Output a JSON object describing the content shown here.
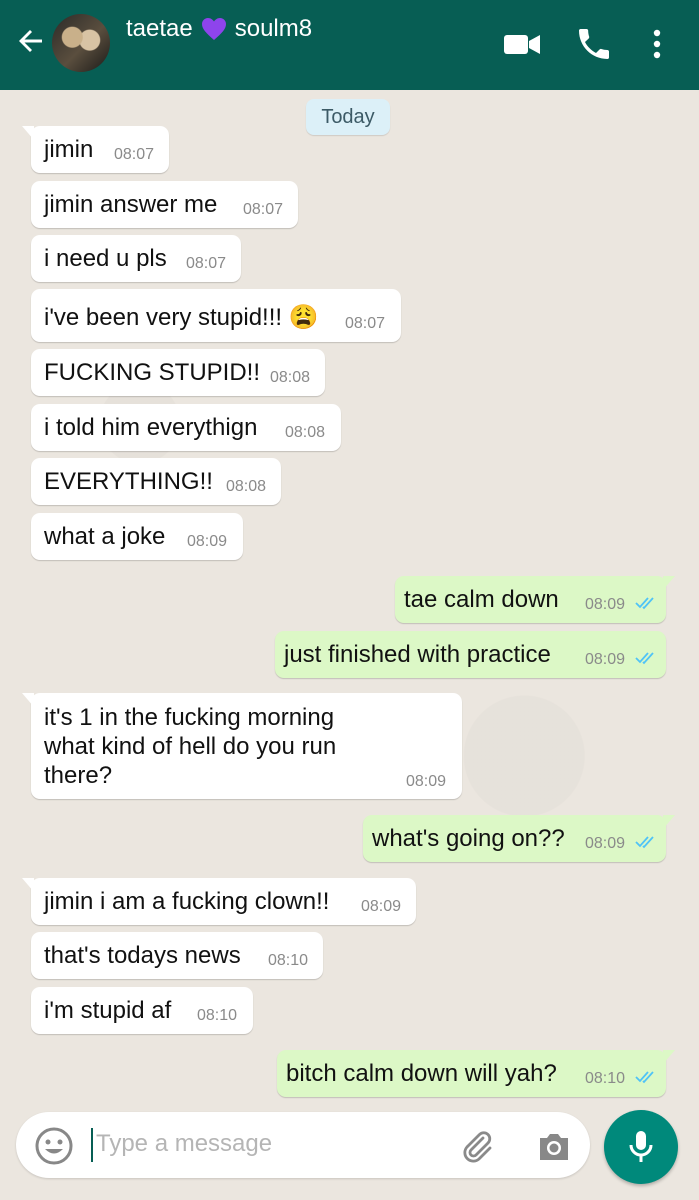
{
  "header": {
    "contact_name_left": "taetae",
    "contact_name_right": "soulm8",
    "icons": [
      "back-arrow-icon",
      "avatar",
      "purple-heart-icon",
      "video-call-icon",
      "phone-icon",
      "more-options-icon"
    ]
  },
  "date_chip": "Today",
  "messages": [
    {
      "dir": "in",
      "text": "jimin",
      "time": "08:07"
    },
    {
      "dir": "in",
      "text": "jimin answer me",
      "time": "08:07"
    },
    {
      "dir": "in",
      "text": "i need u pls",
      "time": "08:07"
    },
    {
      "dir": "in",
      "text": "i've been very stupid!!! 😩",
      "time": "08:07"
    },
    {
      "dir": "in",
      "text": "FUCKING STUPID!!",
      "time": "08:08"
    },
    {
      "dir": "in",
      "text": "i told him everythign",
      "time": "08:08"
    },
    {
      "dir": "in",
      "text": "EVERYTHING!!",
      "time": "08:08"
    },
    {
      "dir": "in",
      "text": "what a joke",
      "time": "08:09"
    },
    {
      "dir": "out",
      "text": "tae calm down",
      "time": "08:09"
    },
    {
      "dir": "out",
      "text": "just finished with practice",
      "time": "08:09"
    },
    {
      "dir": "in",
      "lines": [
        "it's 1 in the fucking morning",
        "what kind of hell do you run",
        "there?"
      ],
      "time": "08:09"
    },
    {
      "dir": "out",
      "text": "what's going on??",
      "time": "08:09"
    },
    {
      "dir": "in",
      "text": "jimin i am a fucking clown!!",
      "time": "08:09"
    },
    {
      "dir": "in",
      "text": "that's todays news",
      "time": "08:10"
    },
    {
      "dir": "in",
      "text": "i'm stupid af",
      "time": "08:10"
    },
    {
      "dir": "out",
      "text": "bitch calm down will yah?",
      "time": "08:10"
    }
  ],
  "input": {
    "placeholder": "Type a message"
  },
  "colors": {
    "header": "#075e54",
    "incoming_bubble": "#ffffff",
    "outgoing_bubble": "#dcf8c6",
    "read_ticks": "#4fc3f7",
    "mic_button": "#00897b",
    "heart": "#8e44ec"
  }
}
